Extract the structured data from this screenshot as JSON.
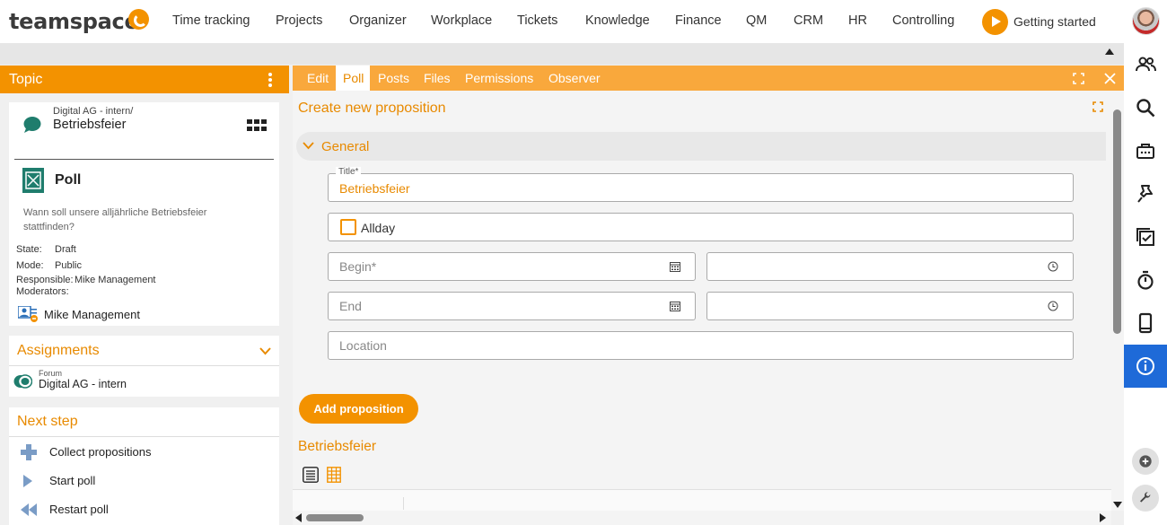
{
  "app": {
    "logo": "teamspace"
  },
  "nav": [
    "Time tracking",
    "Projects",
    "Organizer",
    "Workplace",
    "Tickets",
    "Knowledge",
    "Finance",
    "QM",
    "CRM",
    "HR",
    "Controlling"
  ],
  "getting_started": "Getting started",
  "left": {
    "title": "Topic",
    "topic_path": "Digital AG - intern/",
    "topic_name": "Betriebsfeier",
    "type": "Poll",
    "question": "Wann soll unsere alljährliche Betriebsfeier stattfinden?",
    "state_label": "State:",
    "state_value": "Draft",
    "mode_label": "Mode:",
    "mode_value": "Public",
    "responsible_label": "Responsible:",
    "responsible_value": "Mike Management",
    "moderators_label": "Moderators:",
    "moderator": "Mike Management",
    "assignments_title": "Assignments",
    "assignment_type": "Forum",
    "assignment_name": "Digital AG - intern",
    "next_step_title": "Next step",
    "steps": [
      "Collect propositions",
      "Start poll",
      "Restart poll"
    ]
  },
  "tabs": [
    "Edit",
    "Poll",
    "Posts",
    "Files",
    "Permissions",
    "Observer"
  ],
  "active_tab": "Poll",
  "form": {
    "heading": "Create new proposition",
    "section": "General",
    "title_label": "Title*",
    "title_value": "Betriebsfeier",
    "allday_label": "Allday",
    "allday_checked": false,
    "begin_placeholder": "Begin*",
    "end_placeholder": "End",
    "location_placeholder": "Location",
    "add_button": "Add proposition"
  },
  "poll_title": "Betriebsfeier",
  "colors": {
    "accent": "#f39200",
    "tab_bar": "#f9a83c",
    "link": "#e88a00",
    "active_sidebar": "#1e6ad8"
  }
}
